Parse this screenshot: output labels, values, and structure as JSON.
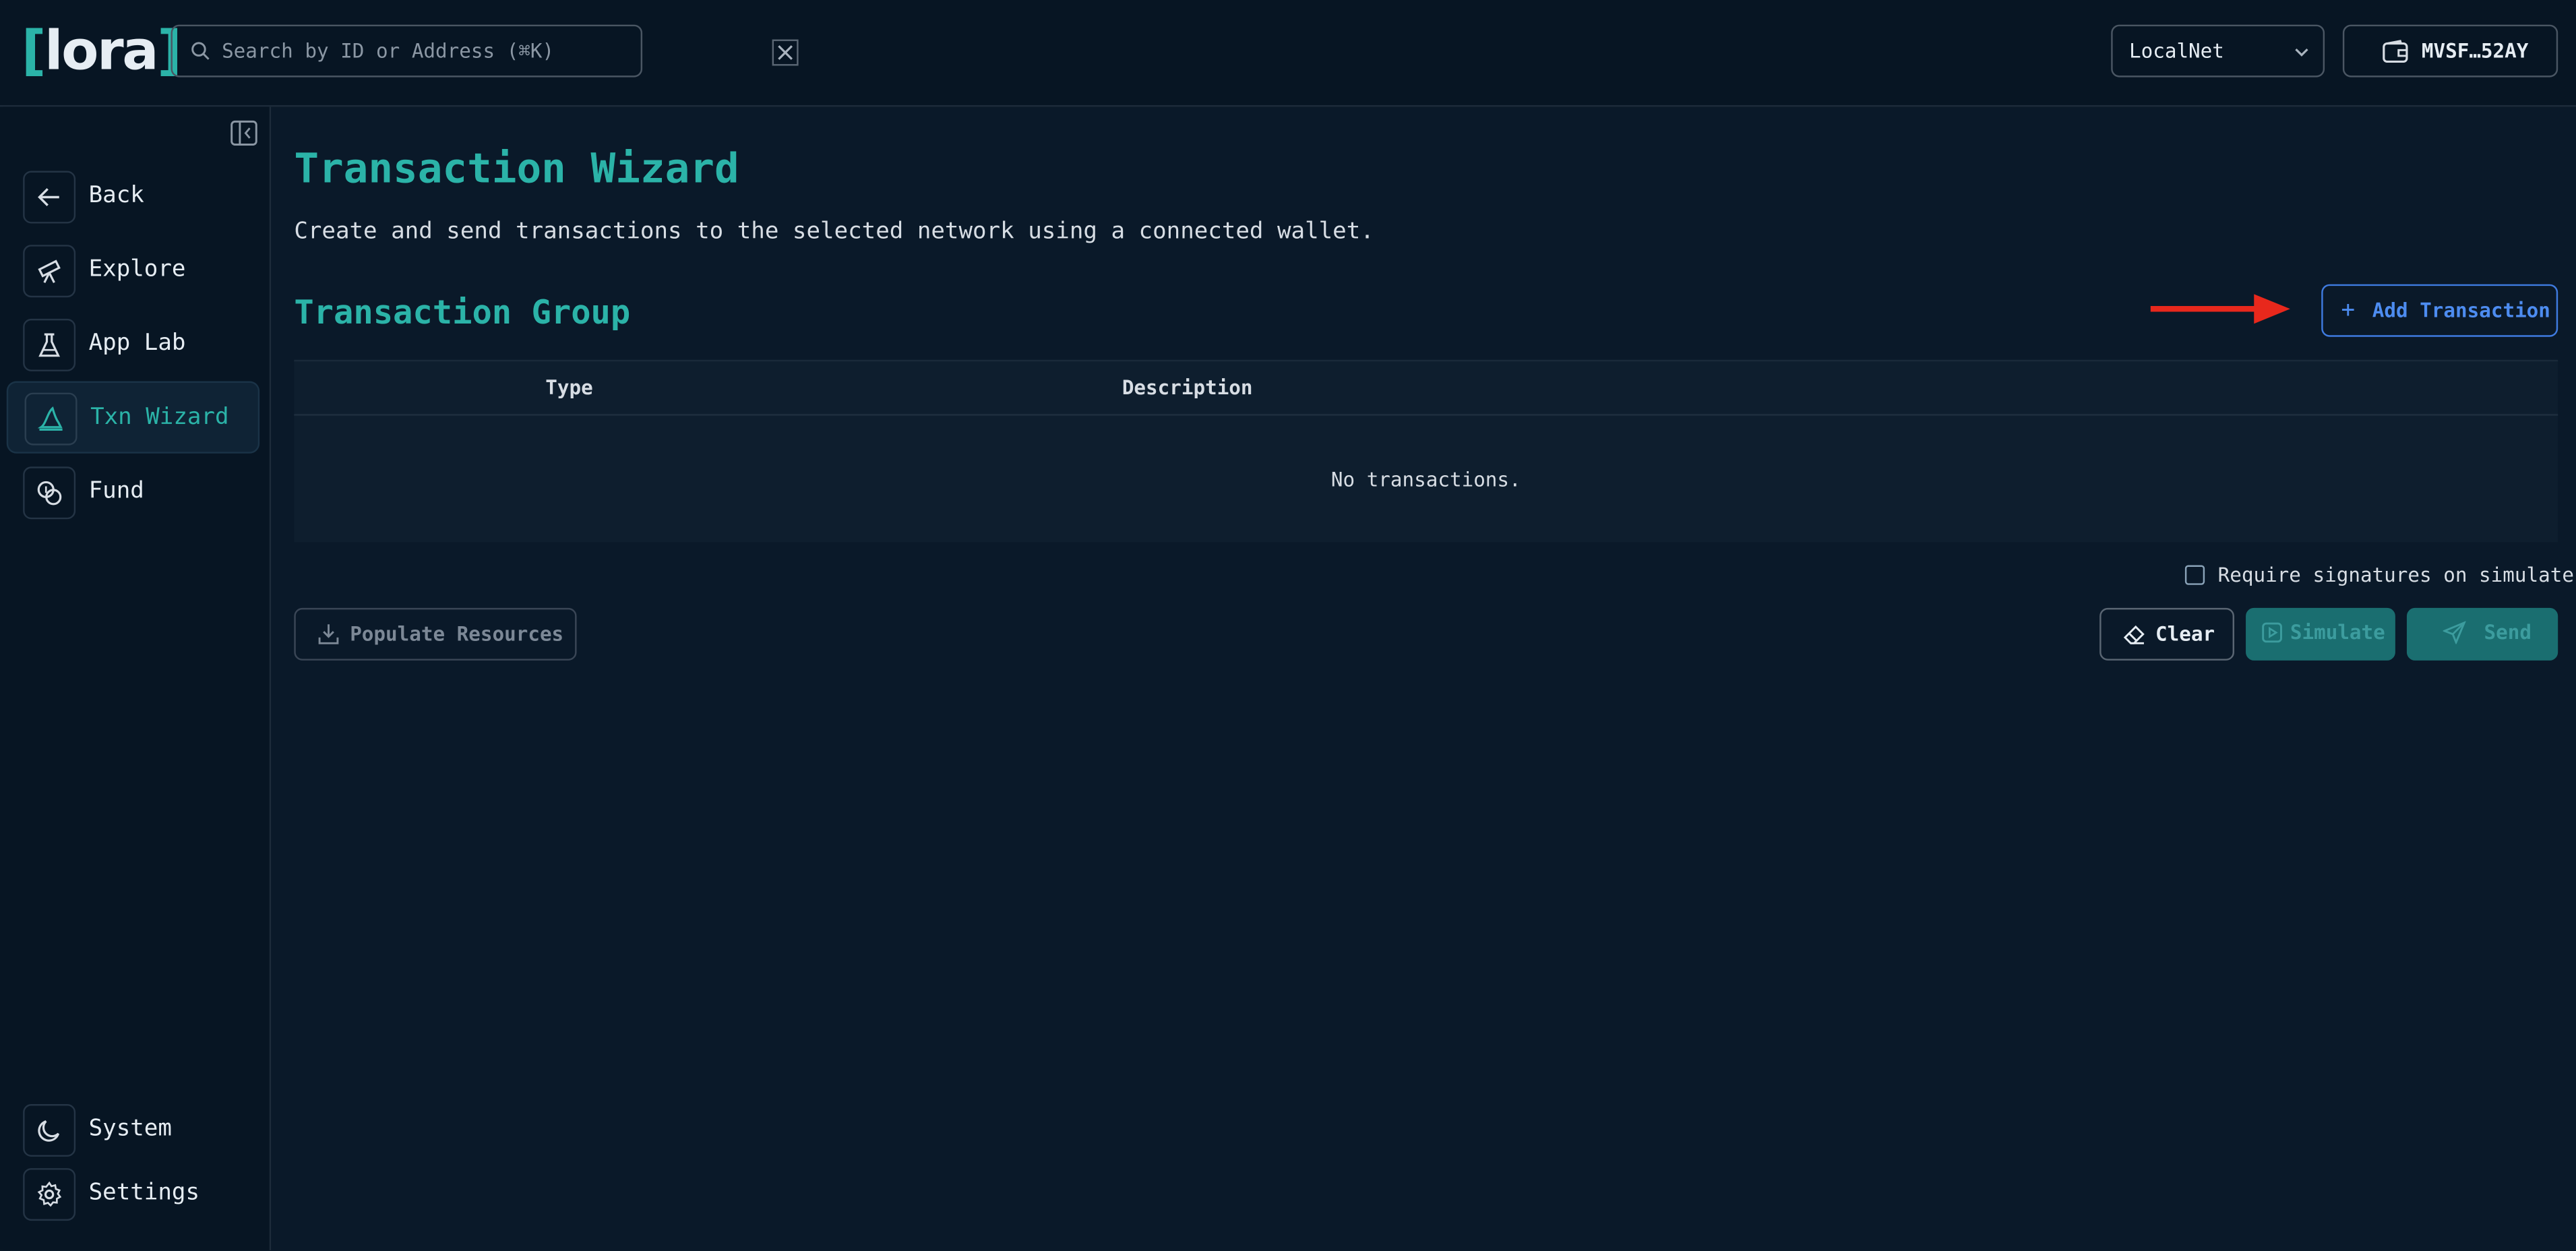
{
  "app": {
    "logo_text": "lora",
    "logo_open": "[",
    "logo_close": "]"
  },
  "header": {
    "search_placeholder": "Search by ID or Address (⌘K)",
    "network": "LocalNet",
    "wallet": "MVSF…52AY"
  },
  "sidebar": {
    "items": [
      {
        "label": "Back",
        "icon": "arrow-left-icon"
      },
      {
        "label": "Explore",
        "icon": "telescope-icon"
      },
      {
        "label": "App Lab",
        "icon": "flask-icon"
      },
      {
        "label": "Txn Wizard",
        "icon": "wizard-hat-icon",
        "active": true
      },
      {
        "label": "Fund",
        "icon": "coins-icon"
      }
    ],
    "bottom": [
      {
        "label": "System",
        "icon": "moon-icon"
      },
      {
        "label": "Settings",
        "icon": "gear-icon"
      }
    ]
  },
  "main": {
    "title": "Transaction Wizard",
    "description": "Create and send transactions to the selected network using a connected wallet.",
    "group_title": "Transaction Group",
    "add_button": "Add Transaction",
    "add_button_plus": "+",
    "table": {
      "columns": [
        "Type",
        "Description"
      ],
      "empty_text": "No transactions."
    },
    "require_signatures": {
      "label": "Require signatures on simulate",
      "checked": false
    },
    "buttons": {
      "populate": "Populate Resources",
      "clear": "Clear",
      "simulate": "Simulate",
      "send": "Send"
    }
  },
  "colors": {
    "accent": "#2bb3a8",
    "link": "#4d8cf0",
    "annotation_arrow": "#e8281c",
    "background": "#0a1929"
  }
}
